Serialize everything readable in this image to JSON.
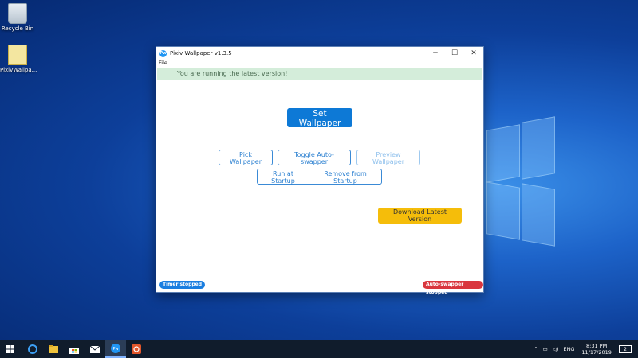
{
  "desktop": {
    "icons": [
      {
        "label": "Recycle Bin",
        "icon": "recycle-bin-icon"
      },
      {
        "label": "PixivWallpa...",
        "icon": "file-icon"
      }
    ]
  },
  "window": {
    "title": "Pixiv Wallpaper v1.3.5",
    "app_icon_text": "Pw",
    "minimize": "─",
    "maximize": "☐",
    "close": "✕",
    "menu": [
      "File"
    ],
    "banner": "You are running the latest version!",
    "buttons": {
      "set_wallpaper": "Set Wallpaper",
      "pick_wallpaper": "Pick Wallpaper",
      "toggle_auto_swapper": "Toggle Auto-swapper",
      "preview_wallpaper": "Preview Wallpaper",
      "run_at_startup": "Run at Startup",
      "remove_from_startup": "Remove from Startup",
      "download_latest": "Download Latest Version"
    },
    "status": {
      "timer": "Timer stopped",
      "auto_swapper": "Auto-swapper stopped"
    }
  },
  "taskbar": {
    "items": [
      "windows-start-icon",
      "edge-icon",
      "file-explorer-icon",
      "store-icon",
      "mail-icon",
      "pixiv-wallpaper-icon",
      "app-icon"
    ],
    "tray": {
      "language": "ENG",
      "time": "8:31 PM",
      "date": "11/17/2019",
      "notifications": "2"
    }
  },
  "colors": {
    "primary": "#0d79d6",
    "warning": "#f5bd0a",
    "success_bg": "#d4edda",
    "badge_blue": "#1a7ee0",
    "badge_red": "#d9363e"
  }
}
